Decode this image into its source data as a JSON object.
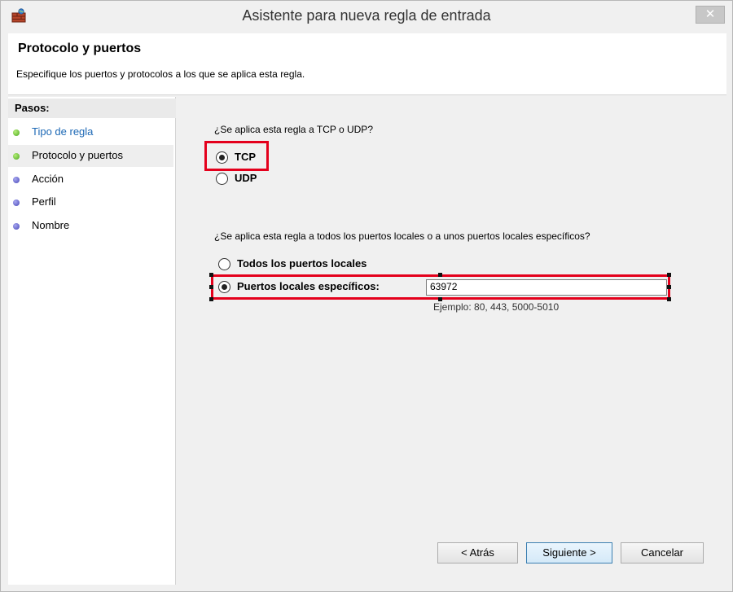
{
  "window": {
    "title": "Asistente para nueva regla de entrada",
    "close_glyph": "✕"
  },
  "header": {
    "title": "Protocolo y puertos",
    "description": "Especifique los puertos y protocolos a los que se aplica esta regla."
  },
  "sidebar": {
    "heading": "Pasos:",
    "items": [
      {
        "label": "Tipo de regla",
        "status": "done"
      },
      {
        "label": "Protocolo y puertos",
        "status": "current"
      },
      {
        "label": "Acción",
        "status": "pending"
      },
      {
        "label": "Perfil",
        "status": "pending"
      },
      {
        "label": "Nombre",
        "status": "pending"
      }
    ]
  },
  "protocol": {
    "question": "¿Se aplica esta regla a TCP o UDP?",
    "options": [
      {
        "label": "TCP",
        "selected": true
      },
      {
        "label": "UDP",
        "selected": false
      }
    ]
  },
  "ports": {
    "question": "¿Se aplica esta regla a todos los puertos locales o a unos puertos locales específicos?",
    "options": [
      {
        "label": "Todos los puertos locales",
        "selected": false
      },
      {
        "label": "Puertos locales específicos:",
        "selected": true
      }
    ],
    "value": "63972",
    "example": "Ejemplo: 80, 443, 5000-5010"
  },
  "buttons": {
    "back": "< Atrás",
    "next": "Siguiente >",
    "cancel": "Cancelar"
  },
  "colors": {
    "highlight": "#e4001c",
    "link": "#1c68b5",
    "step_done": "#4aa81e",
    "step_pending": "#4747b8"
  }
}
